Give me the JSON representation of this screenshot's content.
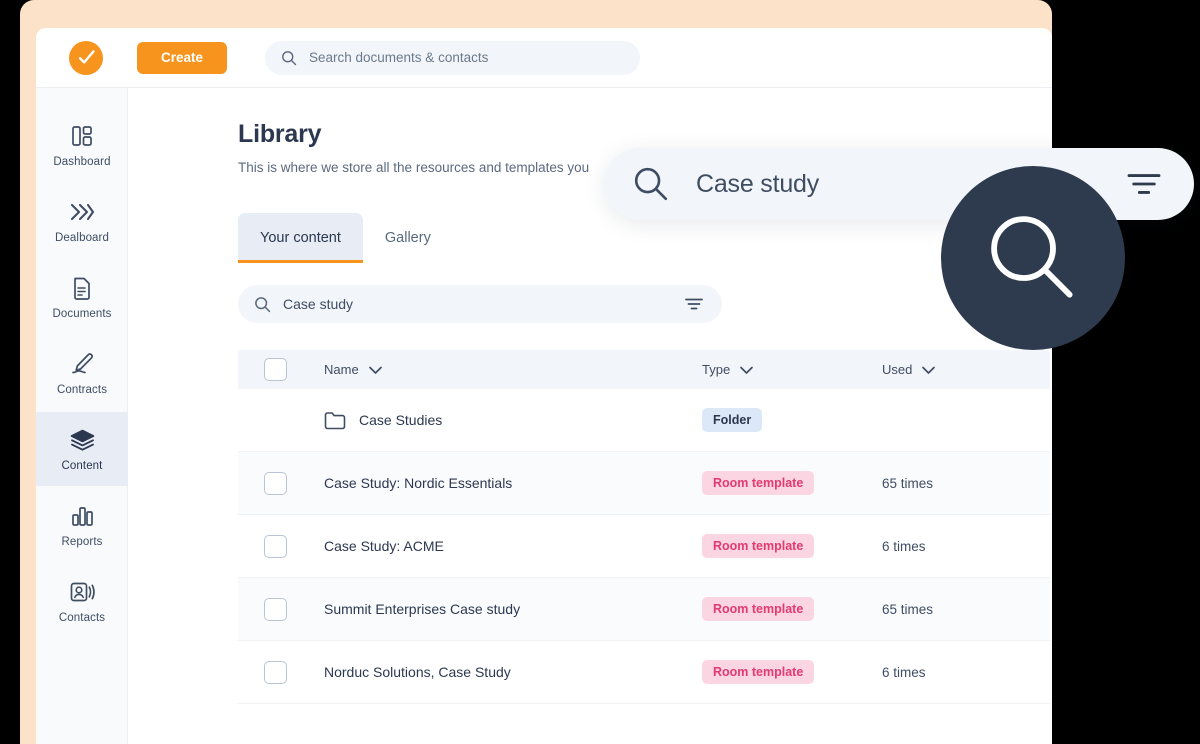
{
  "topbar": {
    "logo_icon": "orange-check-circle-logo",
    "create_label": "Create",
    "search_placeholder": "Search documents & contacts",
    "search_icon": "search-icon"
  },
  "sidebar": {
    "items": [
      {
        "label": "Dashboard",
        "icon": "dashboard-icon",
        "active": false
      },
      {
        "label": "Dealboard",
        "icon": "chevrons-right-icon",
        "active": false
      },
      {
        "label": "Documents",
        "icon": "document-icon",
        "active": false
      },
      {
        "label": "Contracts",
        "icon": "pen-signature-icon",
        "active": false
      },
      {
        "label": "Content",
        "icon": "layers-icon",
        "active": true
      },
      {
        "label": "Reports",
        "icon": "bar-chart-icon",
        "active": false
      },
      {
        "label": "Contacts",
        "icon": "contact-card-icon",
        "active": false
      }
    ]
  },
  "main": {
    "title": "Library",
    "subtitle": "This is where we store all the resources and templates you",
    "tabs": [
      {
        "label": "Your content",
        "active": true
      },
      {
        "label": "Gallery",
        "active": false
      }
    ],
    "inline_search": {
      "value": "Case study",
      "search_icon": "search-icon",
      "filter_icon": "filter-icon"
    },
    "table": {
      "columns": [
        {
          "label": "Name",
          "sort_icon": "chevron-down-icon"
        },
        {
          "label": "Type",
          "sort_icon": "chevron-down-icon"
        },
        {
          "label": "Used",
          "sort_icon": "chevron-down-icon"
        }
      ],
      "rows": [
        {
          "name": "Case Studies",
          "icon": "folder-icon",
          "has_checkbox": false,
          "type": "Folder",
          "type_style": "folder",
          "used": ""
        },
        {
          "name": "Case Study: Nordic Essentials",
          "icon": "",
          "has_checkbox": true,
          "type": "Room template",
          "type_style": "room",
          "used": "65 times"
        },
        {
          "name": "Case Study: ACME",
          "icon": "",
          "has_checkbox": true,
          "type": "Room template",
          "type_style": "room",
          "used": "6 times"
        },
        {
          "name": "Summit Enterprises Case study",
          "icon": "",
          "has_checkbox": true,
          "type": "Room template",
          "type_style": "room",
          "used": "65 times"
        },
        {
          "name": "Norduc Solutions, Case Study",
          "icon": "",
          "has_checkbox": true,
          "type": "Room template",
          "type_style": "room",
          "used": "6 times"
        }
      ]
    }
  },
  "overlay": {
    "search_value": "Case study",
    "search_icon": "search-icon",
    "filter_icon": "filter-icon",
    "badge_icon": "search-icon"
  },
  "colors": {
    "brand_orange": "#f7941d",
    "frame_peach": "#fce2c8",
    "navy": "#2c3850",
    "badge_folder_bg": "#dce8f8",
    "badge_room_bg": "#fbd5e2",
    "badge_room_text": "#e23a71",
    "magnifier_dark": "#2e3a4d"
  }
}
